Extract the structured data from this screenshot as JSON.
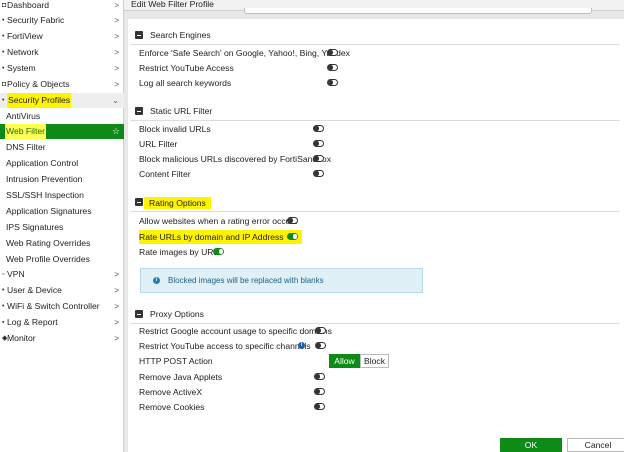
{
  "sidebar": {
    "items": [
      {
        "label": "Dashboard",
        "icon": "dashboard-icon",
        "chevron": ">",
        "top": 0
      },
      {
        "label": "Security Fabric",
        "icon": "security-fabric-icon",
        "chevron": ">"
      },
      {
        "label": "FortiView",
        "icon": "fortiview-icon",
        "chevron": ">"
      },
      {
        "label": "Network",
        "icon": "network-icon",
        "chevron": ">"
      },
      {
        "label": "System",
        "icon": "system-icon",
        "chevron": ">"
      },
      {
        "label": "Policy & Objects",
        "icon": "policy-icon",
        "chevron": ">"
      },
      {
        "label": "Security Profiles",
        "icon": "security-profiles-icon",
        "chevron": "⌄"
      },
      {
        "label": "AntiVirus"
      },
      {
        "label": "Web Filter",
        "star": "☆"
      },
      {
        "label": "DNS Filter"
      },
      {
        "label": "Application Control"
      },
      {
        "label": "Intrusion Prevention"
      },
      {
        "label": "SSL/SSH Inspection"
      },
      {
        "label": "Application Signatures"
      },
      {
        "label": "IPS Signatures"
      },
      {
        "label": "Web Rating Overrides"
      },
      {
        "label": "Web Profile Overrides"
      },
      {
        "label": "VPN",
        "icon": "vpn-icon",
        "chevron": ">"
      },
      {
        "label": "User & Device",
        "icon": "user-icon",
        "chevron": ">"
      },
      {
        "label": "WiFi & Switch Controller",
        "icon": "wifi-icon",
        "chevron": ">"
      },
      {
        "label": "Log & Report",
        "icon": "log-icon",
        "chevron": ">"
      },
      {
        "label": "Monitor",
        "icon": "monitor-icon",
        "chevron": ">"
      }
    ]
  },
  "header": {
    "title": "Edit Web Filter Profile"
  },
  "sections": {
    "search_engines": {
      "title": "Search Engines",
      "rows": [
        {
          "label": "Enforce 'Safe Search' on Google, Yahoo!, Bing, Yandex",
          "on": false
        },
        {
          "label": "Restrict YouTube Access",
          "on": false
        },
        {
          "label": "Log all search keywords",
          "on": false
        }
      ]
    },
    "static_url": {
      "title": "Static URL Filter",
      "rows": [
        {
          "label": "Block invalid URLs",
          "on": false
        },
        {
          "label": "URL Filter",
          "on": false
        },
        {
          "label": "Block malicious URLs discovered by FortiSandbox",
          "on": false
        },
        {
          "label": "Content Filter",
          "on": false
        }
      ]
    },
    "rating_options": {
      "title": "Rating Options",
      "rows": [
        {
          "label": "Allow websites when a rating error occurs",
          "on": false
        },
        {
          "label": "Rate URLs by domain and IP Address",
          "on": true
        },
        {
          "label": "Rate images by URL",
          "on": true
        }
      ],
      "info": "Blocked images will be replaced with blanks"
    },
    "proxy_options": {
      "title": "Proxy Options",
      "rows": [
        {
          "label": "Restrict Google account usage to specific domains",
          "on": false
        },
        {
          "label": "Restrict YouTube access to specific channels",
          "on": false
        },
        {
          "label": "HTTP POST Action"
        },
        {
          "label": "Remove Java Applets",
          "on": false
        },
        {
          "label": "Remove ActiveX",
          "on": false
        },
        {
          "label": "Remove Cookies",
          "on": false
        }
      ],
      "post_action": {
        "allow": "Allow",
        "block": "Block"
      }
    }
  },
  "footer": {
    "ok": "OK",
    "cancel": "Cancel"
  },
  "colors": {
    "accent": "#0e8a16",
    "highlight": "#fff400",
    "info_bg": "#dff0f7"
  }
}
